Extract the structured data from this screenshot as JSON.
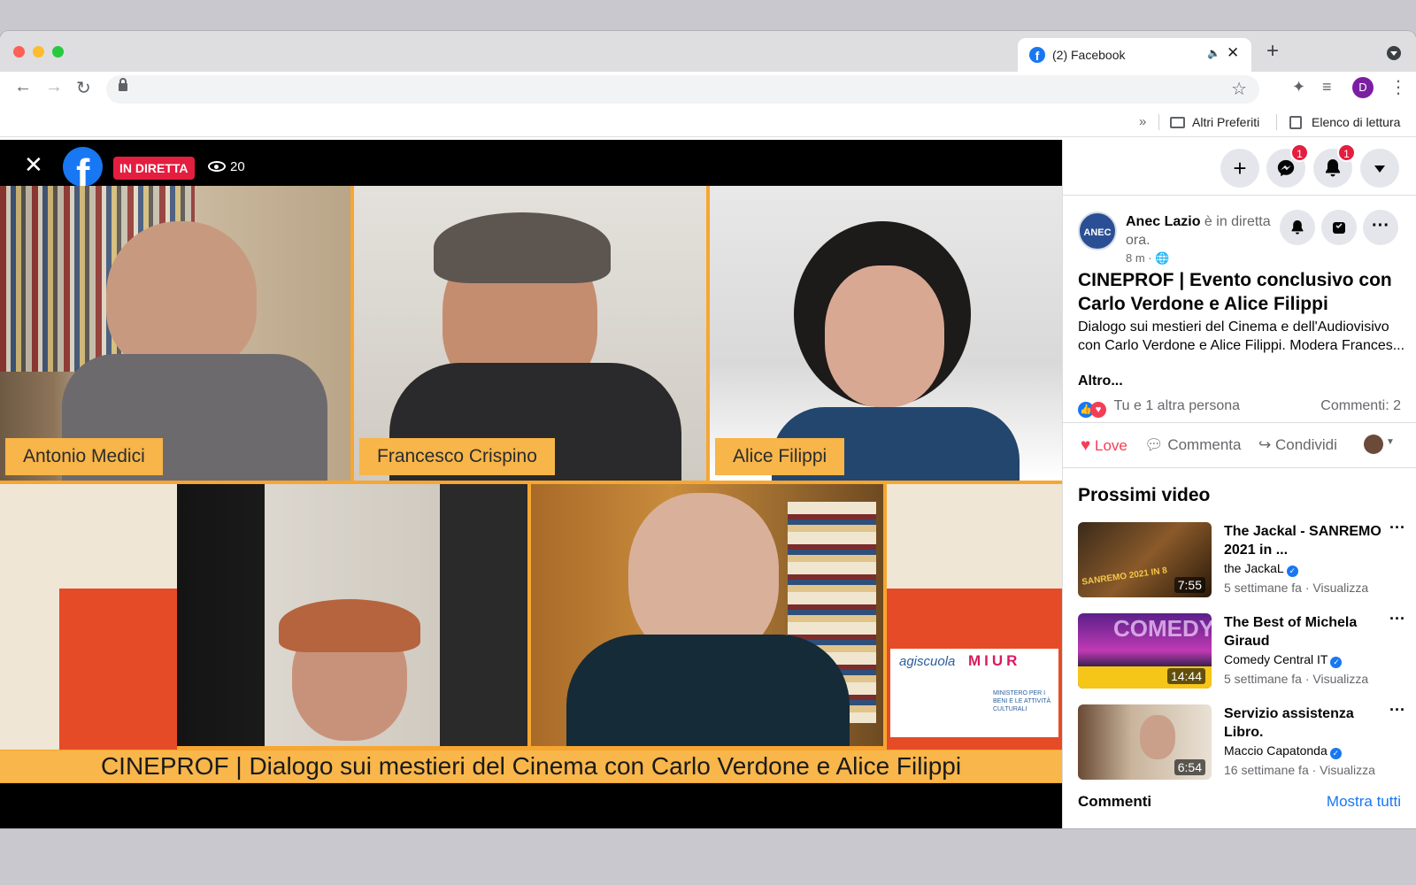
{
  "browser": {
    "tab_title": "(2) Facebook",
    "tab_favicon": "f",
    "tab_audio_icon": "🔈",
    "tab_close": "✕",
    "new_tab": "+",
    "back": "←",
    "forward": "→",
    "reload": "↻",
    "bookmark_star": "☆",
    "extensions_icon": "✦",
    "media_icon": "≡",
    "profile_initial": "D",
    "menu": "⋮",
    "bookmarks_more": "»",
    "bookmarks": [
      "Altri Preferiti",
      "Elenco di lettura"
    ]
  },
  "video": {
    "close": "✕",
    "logo": "f",
    "live_badge": "IN DIRETTA",
    "viewers": "20",
    "participants": [
      "Antonio Medici",
      "Francesco Crispino",
      "Alice Filippi"
    ],
    "caption": "CINEPROF | Dialogo sui mestieri del Cinema con Carlo Verdone e Alice Filippi",
    "sponsor_text": "agiscuola",
    "sponsor_miur": "MIUR",
    "sponsor_ministero": "MINISTERO PER I BENI E LE ATTIVITÀ CULTURALI"
  },
  "sidebar": {
    "top_buttons": {
      "create": "+",
      "messenger_badge": "1",
      "notifications_badge": "1"
    },
    "page_avatar": "ANEC",
    "author_name": "Anec Lazio",
    "author_status": " è in diretta ora.",
    "time": "8 m · 🌐",
    "post_title": "CINEPROF | Evento conclusivo con Carlo Verdone e Alice Filippi",
    "post_text": "Dialogo sui mestieri del Cinema e dell'Audiovisivo con Carlo Verdone e Alice Filippi. Modera Frances...",
    "more": "Altro...",
    "reactions": "Tu e 1 altra persona",
    "comments_count": "Commenti: 2",
    "actions": {
      "love": "Love",
      "comment": "Commenta",
      "share": "Condividi"
    },
    "next_title": "Prossimi video",
    "videos": [
      {
        "title": "The Jackal - SANREMO 2021 in ...",
        "channel": "the JackaL",
        "meta": "5 settimane fa · Visualizza",
        "duration": "7:55",
        "thumb_text": "SANREMO 2021 IN 8"
      },
      {
        "title": "The Best of Michela Giraud",
        "channel": "Comedy Central IT",
        "meta": "5 settimane fa · Visualizza",
        "duration": "14:44",
        "thumb_text": "COMEDY"
      },
      {
        "title": "Servizio assistenza Libro.",
        "channel": "Maccio Capatonda",
        "meta": "16 settimane fa · Visualizza",
        "duration": "6:54",
        "thumb_text": ""
      }
    ],
    "comments_label": "Commenti",
    "show_all": "Mostra tutti"
  }
}
